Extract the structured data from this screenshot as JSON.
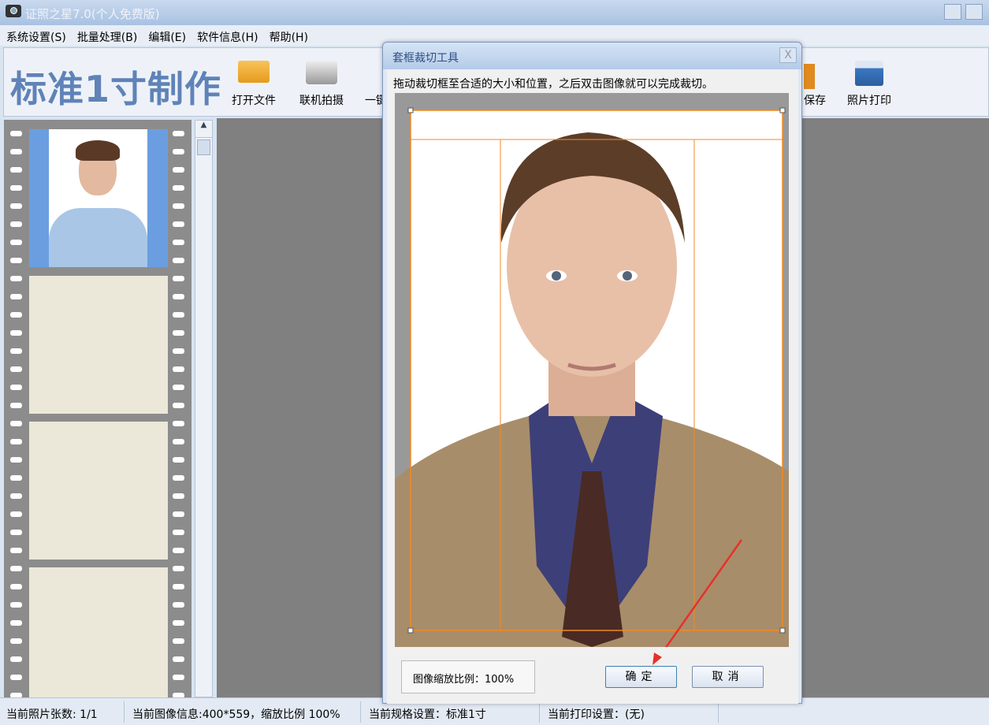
{
  "window": {
    "title": "证照之星7.0(个人免费版)"
  },
  "menu": [
    {
      "label": "系统设置(S)"
    },
    {
      "label": "批量处理(B)"
    },
    {
      "label": "编辑(E)"
    },
    {
      "label": "软件信息(H)"
    },
    {
      "label": "帮助(H)"
    }
  ],
  "toolbar": {
    "brand": "标准1寸制作",
    "open": "打开文件",
    "camera": "联机拍摄",
    "partial": "一键",
    "save": "保存",
    "print": "照片打印"
  },
  "status": {
    "count": "当前照片张数: 1/1",
    "image_info": "当前图像信息:400*559，缩放比例 100%",
    "spec": "当前规格设置：标准1寸",
    "print": "当前打印设置：(无)"
  },
  "dialog": {
    "title": "套框裁切工具",
    "close": "X",
    "instruction": "拖动裁切框至合适的大小和位置，之后双击图像就可以完成裁切。",
    "zoom_label": "图像缩放比例：100%",
    "ok": "确定",
    "cancel": "取消"
  },
  "colors": {
    "crop_frame": "#f08a24",
    "arrow": "#e8302a",
    "brand": "#5f83b8"
  }
}
